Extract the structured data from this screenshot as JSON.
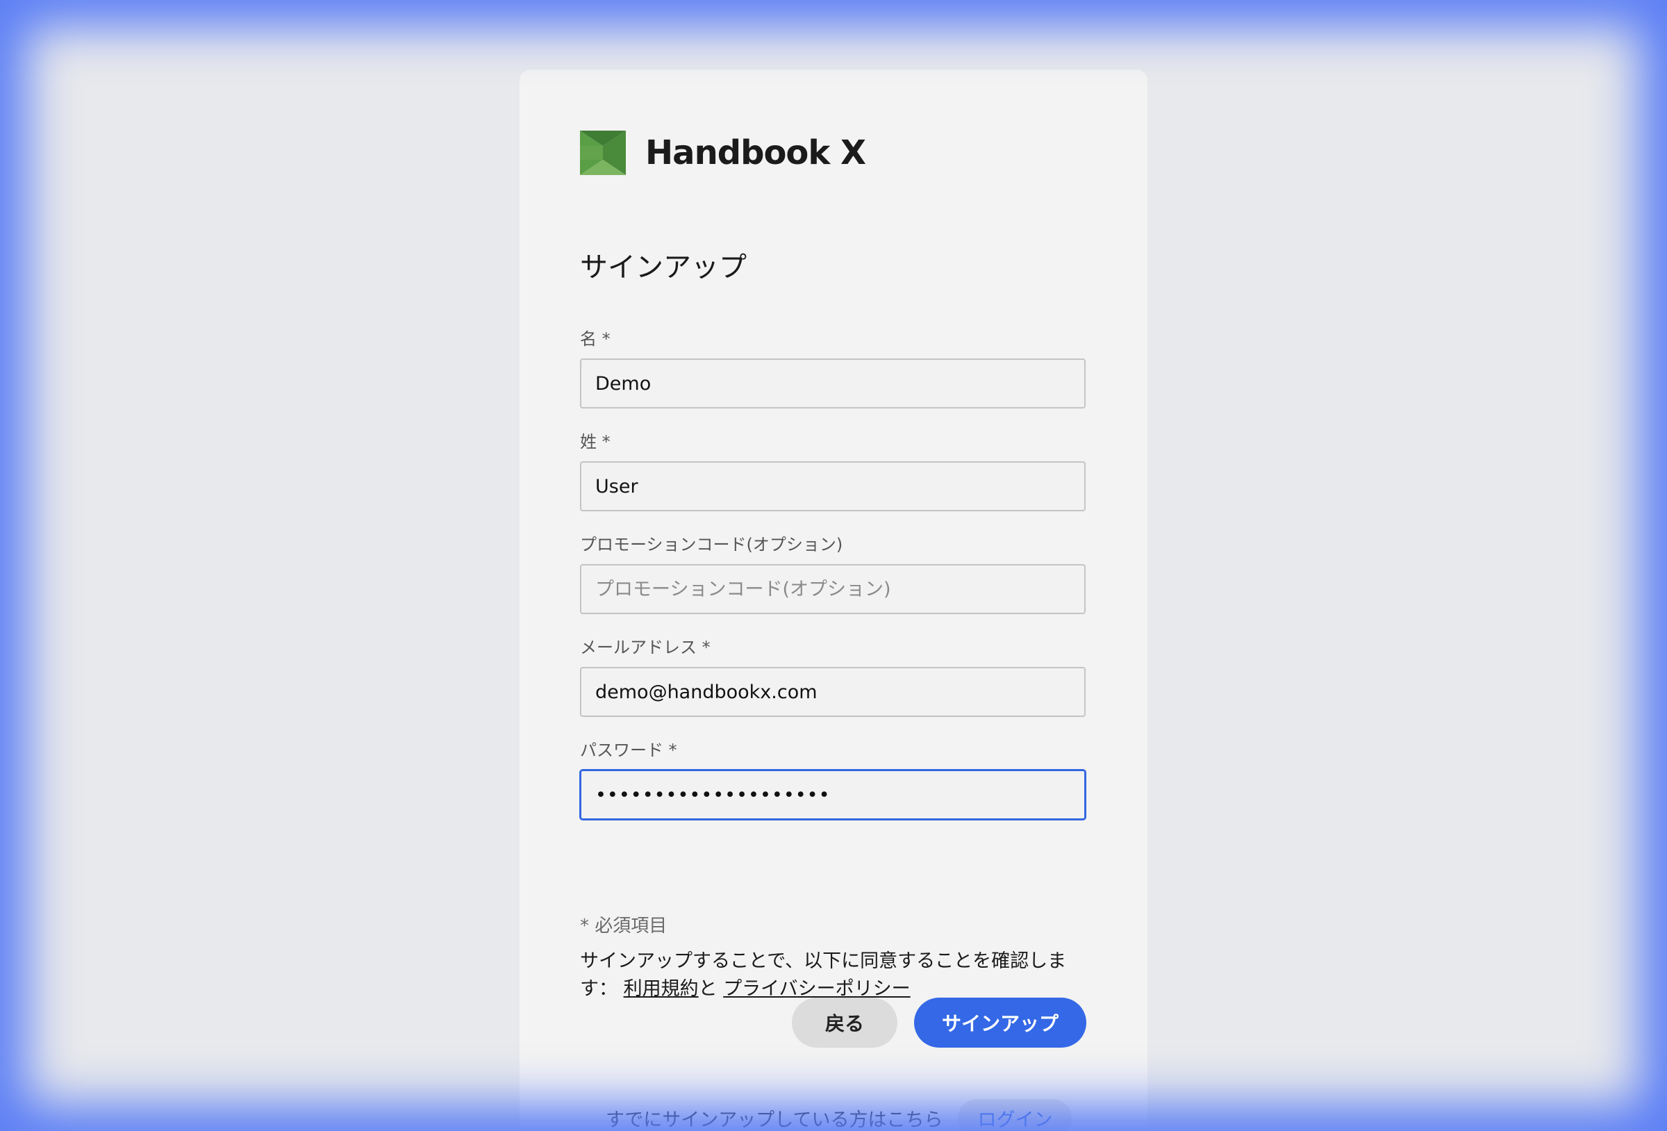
{
  "brand": {
    "name": "Handbook X",
    "logo_icon": "handbook-x-logo-icon",
    "logo_colors": [
      "#5a9e46",
      "#3f7d34",
      "#7cb560"
    ]
  },
  "page": {
    "title": "サインアップ"
  },
  "form": {
    "first_name": {
      "label": "名 *",
      "value": "Demo"
    },
    "last_name": {
      "label": "姓 *",
      "value": "User"
    },
    "promo_code": {
      "label": "プロモーションコード(オプション)",
      "value": "",
      "placeholder": "プロモーションコード(オプション)"
    },
    "email": {
      "label": "メールアドレス *",
      "value": "demo@handbookx.com"
    },
    "password": {
      "label": "パスワード *",
      "value": "••••••••••••••••••••"
    }
  },
  "required_note": "* 必須項目",
  "terms": {
    "prefix": "サインアップすることで、以下に同意することを確認します：",
    "terms_link": "利用規約",
    "connector": "と",
    "privacy_link": "プライバシーポリシー"
  },
  "buttons": {
    "back": "戻る",
    "signup": "サインアップ"
  },
  "footer": {
    "text": "すでにサインアップしている方はこちら",
    "login_link": "ログイン"
  },
  "colors": {
    "accent": "#3468e6",
    "focus_border": "#3467e0",
    "glow": "#5b7ef5"
  }
}
